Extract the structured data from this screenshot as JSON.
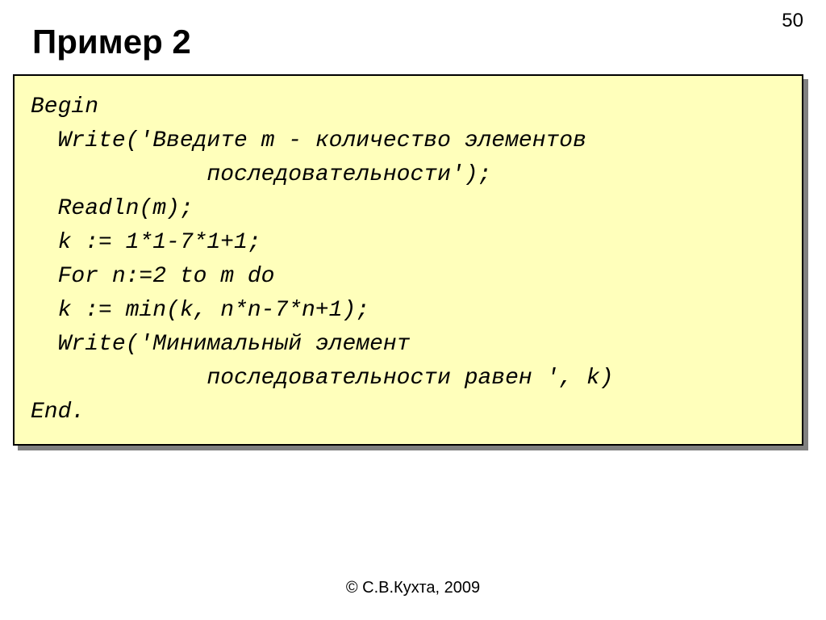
{
  "page_number": "50",
  "title": "Пример 2",
  "code": "Begin\n  Write('Введите m - количество элементов\n             последовательности');\n  Readln(m);\n  k := 1*1-7*1+1;\n  For n:=2 to m do\n  k := min(k, n*n-7*n+1);\n  Write('Минимальный элемент\n             последовательности равен ', k)\nEnd.",
  "footer": "© С.В.Кухта, 2009"
}
